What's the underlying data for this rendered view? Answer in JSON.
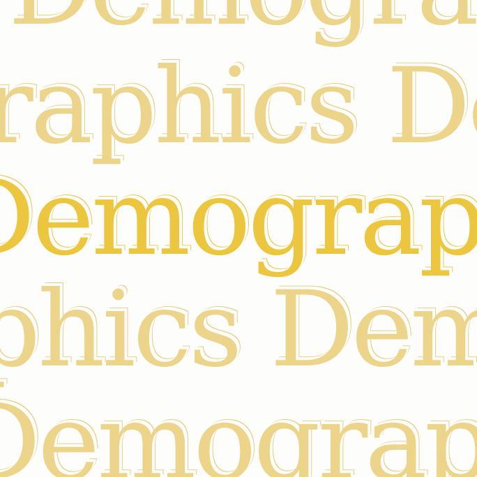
{
  "pattern": {
    "word": "Demographics",
    "rows": [
      {
        "text": "Demographics Demographics"
      },
      {
        "text": "raphics Demographics"
      },
      {
        "text": "Demographics Demographics"
      },
      {
        "text": "phics Demographics"
      },
      {
        "text": "Demographics Demographics"
      }
    ],
    "colors": {
      "background": "#fdfdfb",
      "text": "#ecd58a",
      "highlight_text": "#ecc63f"
    }
  }
}
